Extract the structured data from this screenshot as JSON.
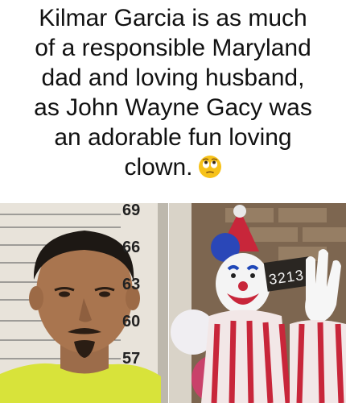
{
  "caption": {
    "lines": [
      "Kilmar Garcia is as much",
      "of a responsible Maryland",
      "dad and loving husband,",
      "as John Wayne Gacy was",
      "an adorable fun loving",
      "clown."
    ],
    "emoji_name": "face-with-rolling-eyes-icon"
  },
  "left_photo": {
    "height_chart_labels": [
      "69",
      "66",
      "63",
      "60",
      "57"
    ]
  },
  "right_photo": {
    "sign_text": "3213"
  },
  "colors": {
    "background": "#ffffff",
    "text": "#111111",
    "emoji_yellow": "#f7c21a",
    "clown_red": "#c8263a",
    "shirt_yellow": "#d8e33a"
  }
}
